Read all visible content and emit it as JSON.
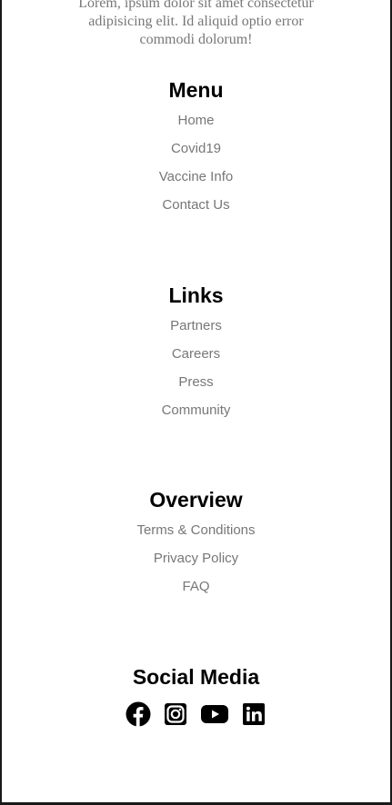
{
  "intro": {
    "text": "Lorem, ipsum dolor sit amet consectetur adipisicing elit. Id aliquid optio error commodi dolorum!"
  },
  "menu": {
    "title": "Menu",
    "items": [
      "Home",
      "Covid19",
      "Vaccine Info",
      "Contact Us"
    ]
  },
  "links": {
    "title": "Links",
    "items": [
      "Partners",
      "Careers",
      "Press",
      "Community"
    ]
  },
  "overview": {
    "title": "Overview",
    "items": [
      "Terms & Conditions",
      "Privacy Policy",
      "FAQ"
    ]
  },
  "social": {
    "title": "Social Media",
    "icons": [
      "facebook-icon",
      "instagram-icon",
      "youtube-icon",
      "linkedin-icon"
    ]
  }
}
